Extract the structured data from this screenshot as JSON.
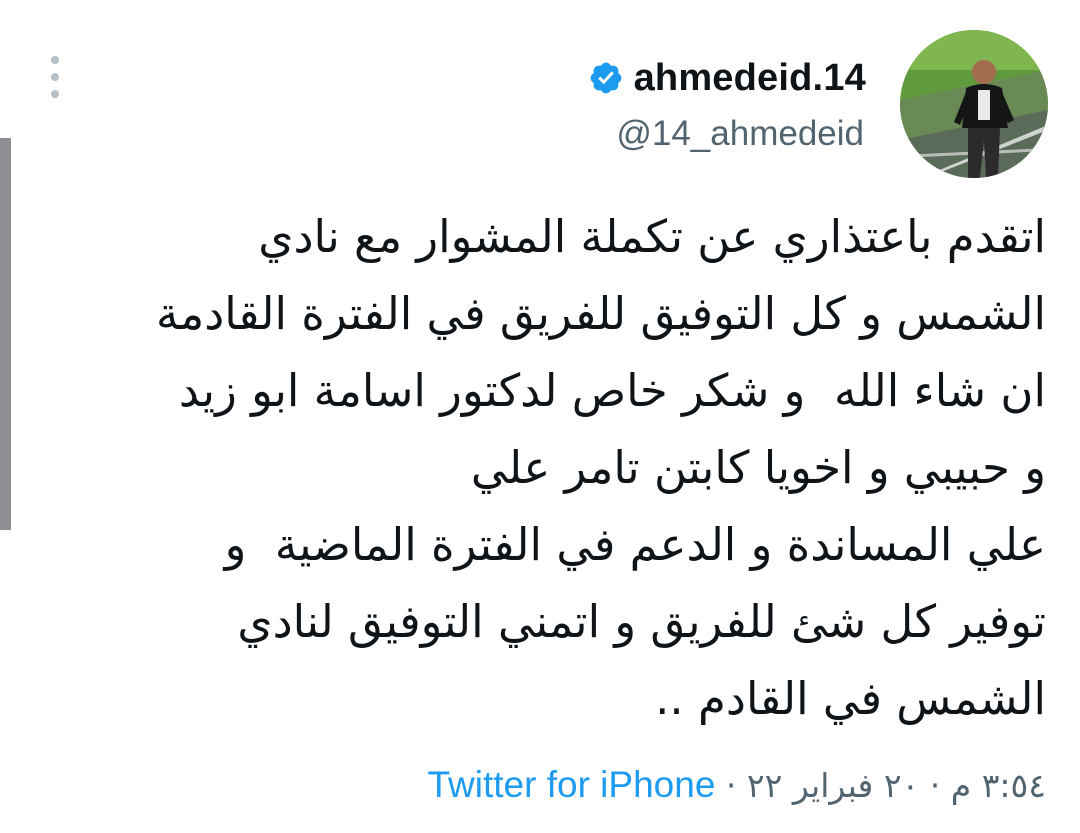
{
  "tweet": {
    "display_name": "ahmedeid.14",
    "handle": "@14_ahmedeid",
    "verified": true,
    "icons": {
      "verified": "verified-badge-icon",
      "more": "more-vertical-icon"
    },
    "text_lines": [
      "اتقدم باعتذاري عن تكملة المشوار مع نادي",
      "الشمس و كل التوفيق للفريق في الفترة القادمة",
      "ان شاء الله  و شكر خاص لدكتور اسامة ابو زيد",
      "و حبيبي و اخويا كابتن تامر علي",
      "علي المساندة و الدعم في الفترة الماضية  و",
      "توفير كل شئ للفريق و اتمني التوفيق لنادي",
      "الشمس في القادم .."
    ],
    "time": "٣:٥٤ م",
    "date": "٢٠ فبراير ٢٢",
    "separator": "·",
    "source": "Twitter for iPhone"
  },
  "colors": {
    "text": "#0f1419",
    "secondary": "#536471",
    "link": "#1d9bf0",
    "verified": "#1d9bf0",
    "scrollbar": "#8e8f92"
  }
}
